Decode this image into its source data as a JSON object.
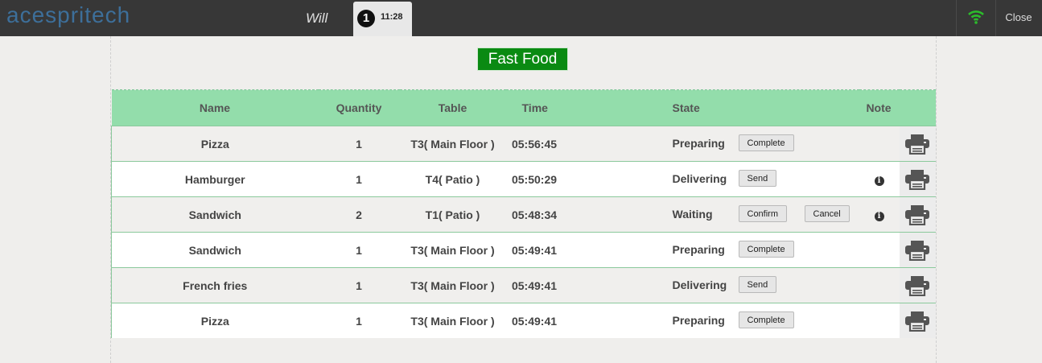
{
  "header": {
    "logo_text": "acespritech",
    "user": "Will",
    "active_tab": {
      "number": "1",
      "time": "11:28"
    },
    "wifi_color": "#2bbd2b",
    "close_label": "Close"
  },
  "category": {
    "label": "Fast Food",
    "color": "#0a8a12"
  },
  "table": {
    "header_color": "#93ddab",
    "columns": {
      "name": "Name",
      "quantity": "Quantity",
      "table": "Table",
      "time": "Time",
      "state": "State",
      "note": "Note"
    },
    "rows": [
      {
        "name": "Pizza",
        "quantity": "1",
        "table": "T3( Main Floor )",
        "time": "05:56:45",
        "state": "Preparing",
        "actions": [
          "Complete"
        ],
        "note_icon": false
      },
      {
        "name": "Hamburger",
        "quantity": "1",
        "table": "T4( Patio )",
        "time": "05:50:29",
        "state": "Delivering",
        "actions": [
          "Send"
        ],
        "note_icon": true
      },
      {
        "name": "Sandwich",
        "quantity": "2",
        "table": "T1( Patio )",
        "time": "05:48:34",
        "state": "Waiting",
        "actions": [
          "Confirm",
          "Cancel"
        ],
        "note_icon": true
      },
      {
        "name": "Sandwich",
        "quantity": "1",
        "table": "T3( Main Floor )",
        "time": "05:49:41",
        "state": "Preparing",
        "actions": [
          "Complete"
        ],
        "note_icon": false
      },
      {
        "name": "French fries",
        "quantity": "1",
        "table": "T3( Main Floor )",
        "time": "05:49:41",
        "state": "Delivering",
        "actions": [
          "Send"
        ],
        "note_icon": false
      },
      {
        "name": "Pizza",
        "quantity": "1",
        "table": "T3( Main Floor )",
        "time": "05:49:41",
        "state": "Preparing",
        "actions": [
          "Complete"
        ],
        "note_icon": false
      }
    ]
  }
}
